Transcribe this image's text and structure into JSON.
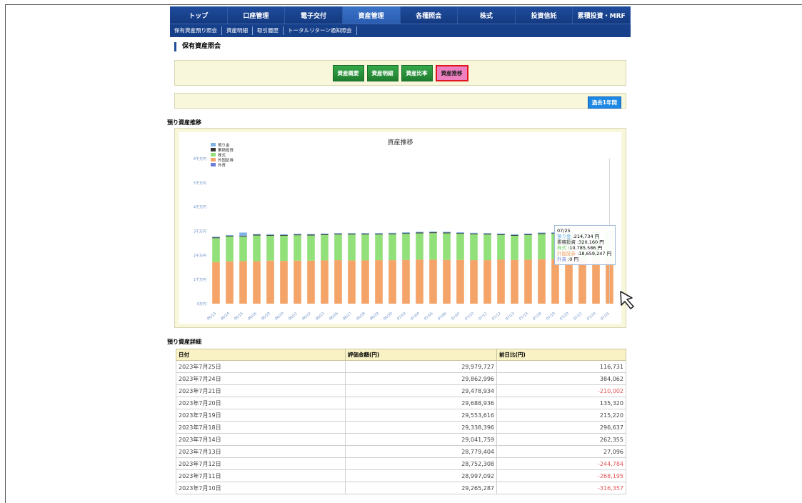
{
  "nav": {
    "top_tabs": [
      {
        "label": "トップ"
      },
      {
        "label": "口座管理"
      },
      {
        "label": "電子交付"
      },
      {
        "label": "資産管理"
      },
      {
        "label": "各種照会"
      },
      {
        "label": "株式"
      },
      {
        "label": "投資信託"
      },
      {
        "label": "累積投資・MRF"
      }
    ],
    "active_tab": "資産管理",
    "sub_tabs": [
      {
        "label": "保有資産預り照会"
      },
      {
        "label": "資産明細"
      },
      {
        "label": "取引履歴"
      },
      {
        "label": "トータルリターン通知照会"
      }
    ]
  },
  "page_title": "保有資産照会",
  "view_buttons": [
    {
      "label": "資産概要"
    },
    {
      "label": "資産明細"
    },
    {
      "label": "資産比率"
    },
    {
      "label": "資産推移"
    }
  ],
  "selected_view": "資産推移",
  "period_button": "過去1年間",
  "chart_section_title": "預り資産推移",
  "detail_section_title": "預り資産詳細",
  "colors": {
    "deposit": "#7fb2e5",
    "cumulative": "#333333",
    "stock": "#92e07a",
    "foreign": "#f4a468",
    "fx": "#6d7ed6"
  },
  "chart_data": {
    "type": "bar",
    "stacked": true,
    "title": "資産推移",
    "ylim": [
      0,
      60000000
    ],
    "y_ticks": [
      "0万円",
      "1千万円",
      "2千万円",
      "3千万円",
      "4千万円",
      "5千万円",
      "6千万円"
    ],
    "categories": [
      "06/13",
      "06/14",
      "06/15",
      "06/16",
      "06/19",
      "06/20",
      "06/21",
      "06/22",
      "06/23",
      "06/26",
      "06/27",
      "06/28",
      "06/29",
      "06/30",
      "07/03",
      "07/04",
      "07/05",
      "07/06",
      "07/07",
      "07/10",
      "07/11",
      "07/12",
      "07/13",
      "07/14",
      "07/18",
      "07/19",
      "07/20",
      "07/21",
      "07/24",
      "07/25"
    ],
    "series": [
      {
        "name": "預り金",
        "values": [
          300000,
          300000,
          1400000,
          300000,
          300000,
          300000,
          300000,
          300000,
          300000,
          300000,
          300000,
          300000,
          300000,
          300000,
          300000,
          300000,
          300000,
          300000,
          300000,
          300000,
          300000,
          300000,
          300000,
          300000,
          300000,
          300000,
          300000,
          300000,
          250000,
          214734
        ]
      },
      {
        "name": "累積投資",
        "values": [
          320000,
          320000,
          320000,
          320000,
          320000,
          320000,
          320000,
          320000,
          320000,
          320000,
          320000,
          320000,
          320000,
          320000,
          320000,
          320000,
          320000,
          320000,
          320000,
          320000,
          320000,
          320000,
          320000,
          320000,
          320000,
          320000,
          320000,
          320000,
          320160,
          320160
        ]
      },
      {
        "name": "株式",
        "values": [
          9900000,
          10300000,
          10100000,
          10600000,
          10300000,
          10400000,
          10500000,
          10400000,
          10500000,
          10600000,
          10700000,
          10700000,
          10600000,
          10700000,
          10800000,
          10900000,
          11000000,
          11000000,
          10800000,
          10700000,
          10600000,
          10200000,
          10000000,
          10200000,
          10500000,
          10500000,
          10600000,
          10400000,
          10700000,
          10785586
        ]
      },
      {
        "name": "外国証券",
        "values": [
          17200000,
          17500000,
          17600000,
          17600000,
          17800000,
          17700000,
          17800000,
          17800000,
          17900000,
          18000000,
          17900000,
          17900000,
          18000000,
          18000000,
          18100000,
          18200000,
          18200000,
          18100000,
          18100000,
          18000000,
          18000000,
          18200000,
          18100000,
          18200000,
          18300000,
          18400000,
          18500000,
          18400000,
          18550000,
          18659247
        ]
      },
      {
        "name": "外貨",
        "values": [
          0,
          0,
          0,
          0,
          0,
          0,
          0,
          0,
          0,
          0,
          0,
          0,
          0,
          0,
          0,
          0,
          0,
          0,
          0,
          0,
          0,
          0,
          0,
          0,
          0,
          0,
          0,
          0,
          0,
          0
        ]
      }
    ],
    "tooltip": {
      "date": "07/25",
      "rows": [
        {
          "label": "預り金",
          "value": "214,734",
          "unit": "円"
        },
        {
          "label": "累積投資",
          "value": "320,160",
          "unit": "円"
        },
        {
          "label": "株式",
          "value": "10,785,586",
          "unit": "円"
        },
        {
          "label": "外国証券",
          "value": "18,659,247",
          "unit": "円"
        },
        {
          "label": "外貨",
          "value": "0",
          "unit": "円"
        }
      ]
    }
  },
  "table": {
    "headers": [
      "日付",
      "評価金額(円)",
      "前日比(円)"
    ],
    "rows": [
      {
        "date": "2023年7月25日",
        "value": "29,979,727",
        "diff": "116,731",
        "neg": false
      },
      {
        "date": "2023年7月24日",
        "value": "29,862,996",
        "diff": "384,062",
        "neg": false
      },
      {
        "date": "2023年7月21日",
        "value": "29,478,934",
        "diff": "-210,002",
        "neg": true
      },
      {
        "date": "2023年7月20日",
        "value": "29,688,936",
        "diff": "135,320",
        "neg": false
      },
      {
        "date": "2023年7月19日",
        "value": "29,553,616",
        "diff": "215,220",
        "neg": false
      },
      {
        "date": "2023年7月18日",
        "value": "29,338,396",
        "diff": "296,637",
        "neg": false
      },
      {
        "date": "2023年7月14日",
        "value": "29,041,759",
        "diff": "262,355",
        "neg": false
      },
      {
        "date": "2023年7月13日",
        "value": "28,779,404",
        "diff": "27,096",
        "neg": false
      },
      {
        "date": "2023年7月12日",
        "value": "28,752,308",
        "diff": "-244,784",
        "neg": true
      },
      {
        "date": "2023年7月11日",
        "value": "28,997,092",
        "diff": "-268,195",
        "neg": true
      },
      {
        "date": "2023年7月10日",
        "value": "29,265,287",
        "diff": "-316,357",
        "neg": true
      }
    ]
  }
}
